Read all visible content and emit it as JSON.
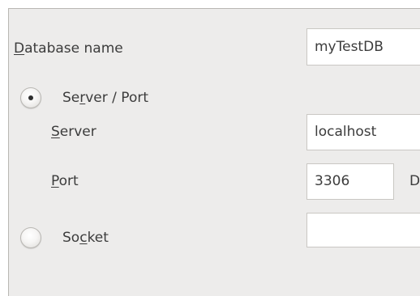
{
  "connection": {
    "database_name": {
      "label_accel": "D",
      "label_rest": "atabase name",
      "value": "myTestDB"
    },
    "server_port_option": {
      "label_pre": "Se",
      "label_accel": "r",
      "label_rest": "ver / Port",
      "selected": true
    },
    "server": {
      "label_accel": "S",
      "label_rest": "erver",
      "value": "localhost"
    },
    "port": {
      "label_accel": "P",
      "label_rest": "ort",
      "value": "3306",
      "trailing_text": "D"
    },
    "socket_option": {
      "label_pre": "So",
      "label_accel": "c",
      "label_rest": "ket",
      "selected": false,
      "value": ""
    }
  }
}
